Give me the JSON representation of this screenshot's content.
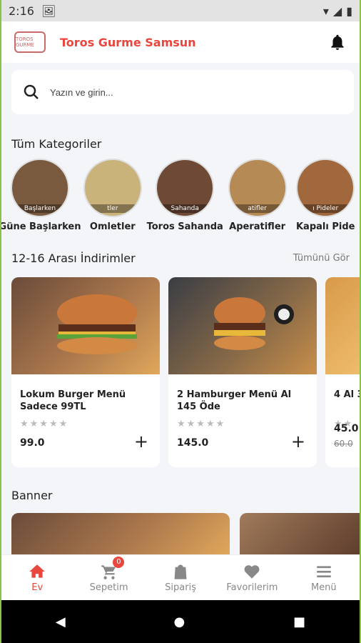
{
  "status": {
    "time": "2:16"
  },
  "app": {
    "brand": "Toros Gurme Samsun",
    "logo_text": "TOROS GURME"
  },
  "search": {
    "placeholder": "Yazın ve girin..."
  },
  "categories_title": "Tüm Kategoriler",
  "categories": [
    {
      "label": "Güne Başlarken",
      "overlay": "Başlarken",
      "color": "#7a5a3f"
    },
    {
      "label": "Omletler",
      "overlay": "tler",
      "color": "#c9b37a"
    },
    {
      "label": "Toros Sahanda",
      "overlay": "Sahanda",
      "color": "#6e4a36"
    },
    {
      "label": "Aperatifler",
      "overlay": "atifler",
      "color": "#b58a55"
    },
    {
      "label": "Kapalı Pide",
      "overlay": "ı Pideler",
      "color": "#a0683c"
    }
  ],
  "discounts": {
    "title": "12-16 Arası İndirimler",
    "see_all": "Tümünü Gör"
  },
  "products": [
    {
      "title": "Lokum Burger Menü Sadece 99TL",
      "stars": "★★★★★",
      "price": "99.0"
    },
    {
      "title": "2 Hamburger Menü Al 145 Öde",
      "stars": "★★★★★",
      "price": "145.0"
    },
    {
      "title": "4 Al 3",
      "stars": "★★",
      "price": "45.0",
      "old_price": "60.0"
    }
  ],
  "banner_title": "Banner",
  "nav": {
    "home": "Ev",
    "cart": "Sepetim",
    "cart_badge": "0",
    "orders": "Sipariş",
    "favorites": "Favorilerim",
    "menu": "Menü"
  },
  "colors": {
    "accent": "#e9463d"
  }
}
